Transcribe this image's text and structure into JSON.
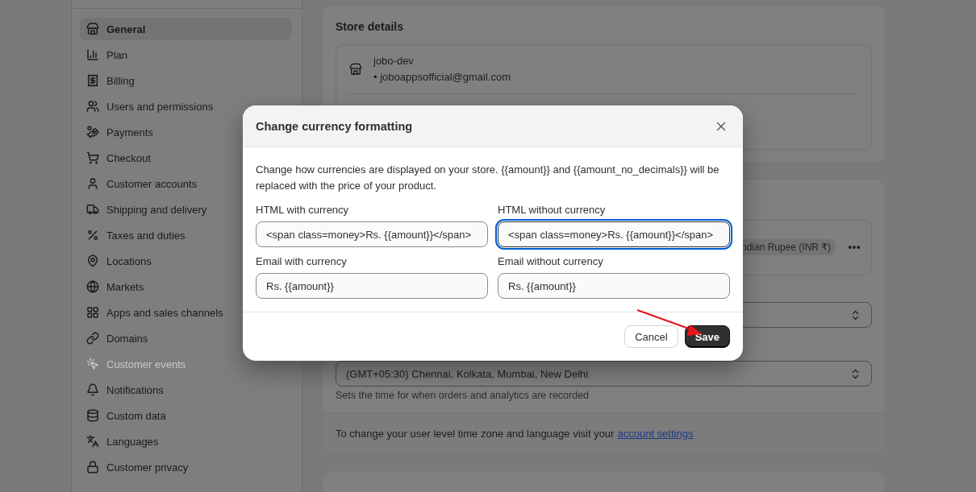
{
  "sidebar": {
    "items": [
      {
        "label": "General",
        "selected": true,
        "disabled": false
      },
      {
        "label": "Plan",
        "selected": false,
        "disabled": false
      },
      {
        "label": "Billing",
        "selected": false,
        "disabled": false
      },
      {
        "label": "Users and permissions",
        "selected": false,
        "disabled": false
      },
      {
        "label": "Payments",
        "selected": false,
        "disabled": false
      },
      {
        "label": "Checkout",
        "selected": false,
        "disabled": false
      },
      {
        "label": "Customer accounts",
        "selected": false,
        "disabled": false
      },
      {
        "label": "Shipping and delivery",
        "selected": false,
        "disabled": false
      },
      {
        "label": "Taxes and duties",
        "selected": false,
        "disabled": false
      },
      {
        "label": "Locations",
        "selected": false,
        "disabled": false
      },
      {
        "label": "Markets",
        "selected": false,
        "disabled": false
      },
      {
        "label": "Apps and sales channels",
        "selected": false,
        "disabled": false
      },
      {
        "label": "Domains",
        "selected": false,
        "disabled": false
      },
      {
        "label": "Customer events",
        "selected": false,
        "disabled": true
      },
      {
        "label": "Notifications",
        "selected": false,
        "disabled": false
      },
      {
        "label": "Custom data",
        "selected": false,
        "disabled": false
      },
      {
        "label": "Languages",
        "selected": false,
        "disabled": false
      },
      {
        "label": "Customer privacy",
        "selected": false,
        "disabled": false
      }
    ]
  },
  "store_details": {
    "title": "Store details",
    "name": "jobo-dev",
    "email": "• joboappsofficial@gmail.com"
  },
  "currency": {
    "badge": "ndian Rupee (INR ₹)"
  },
  "timezone": {
    "value": "(GMT+05:30) Chennai, Kolkata, Mumbai, New Delhi",
    "help": "Sets the time for when orders and analytics are recorded"
  },
  "account_note": {
    "text": "To change your user level time zone and language visit your",
    "link": "account settings"
  },
  "dialog": {
    "title": "Change currency formatting",
    "description": "Change how currencies are displayed on your store. {{amount}} and {{amount_no_decimals}} will be replaced with the price of your product.",
    "fields": [
      {
        "label": "HTML with currency",
        "value": "<span class=money>Rs. {{amount}}</span>",
        "focused": false
      },
      {
        "label": "HTML without currency",
        "value": "<span class=money>Rs. {{amount}}</span>",
        "focused": true
      },
      {
        "label": "Email with currency",
        "value": "Rs. {{amount}}",
        "focused": false
      },
      {
        "label": "Email without currency",
        "value": "Rs. {{amount}}",
        "focused": false
      }
    ],
    "buttons": [
      {
        "label": "Cancel",
        "kind": "secondary"
      },
      {
        "label": "Save",
        "kind": "primary"
      }
    ]
  }
}
